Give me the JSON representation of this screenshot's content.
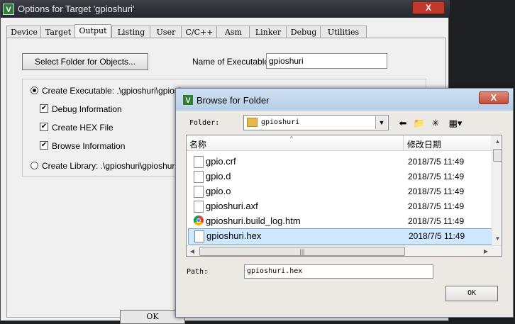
{
  "options_window": {
    "title": "Options for Target 'gpioshuri'",
    "app_icon": "V",
    "close_label": "X",
    "tabs": [
      {
        "label": "Device"
      },
      {
        "label": "Target"
      },
      {
        "label": "Output"
      },
      {
        "label": "Listing"
      },
      {
        "label": "User"
      },
      {
        "label": "C/C++"
      },
      {
        "label": "Asm"
      },
      {
        "label": "Linker"
      },
      {
        "label": "Debug"
      },
      {
        "label": "Utilities"
      }
    ],
    "active_tab": "Output",
    "select_folder_label": "Select Folder for Objects...",
    "name_label": "Name of Executable:",
    "name_value": "gpioshuri",
    "create_exe_label": "Create Executable:  .\\gpioshuri\\gpioshu",
    "create_exe_selected": true,
    "debug_info_label": "Debug Information",
    "create_hex_label": "Create HEX File",
    "browse_info_label": "Browse Information",
    "create_lib_label": "Create Library:  .\\gpioshuri\\gpioshuri.lib",
    "ok_label": "OK"
  },
  "browse_dialog": {
    "title": "Browse for Folder",
    "app_icon": "V",
    "close_label": "X",
    "folder_label": "Folder:",
    "folder_value": "gpioshuri",
    "columns": {
      "name": "名称",
      "date": "修改日期"
    },
    "files": [
      {
        "name": "gpio.crf",
        "date": "2018/7/5 11:49",
        "icon": "file-icon"
      },
      {
        "name": "gpio.d",
        "date": "2018/7/5 11:49",
        "icon": "file-icon"
      },
      {
        "name": "gpio.o",
        "date": "2018/7/5 11:49",
        "icon": "file-icon"
      },
      {
        "name": "gpioshuri.axf",
        "date": "2018/7/5 11:49",
        "icon": "file-icon"
      },
      {
        "name": "gpioshuri.build_log.htm",
        "date": "2018/7/5 11:49",
        "icon": "chrome-icon"
      },
      {
        "name": "gpioshuri.hex",
        "date": "2018/7/5 11:49",
        "icon": "file-icon",
        "selected": true
      }
    ],
    "path_label": "Path:",
    "path_value": "gpioshuri.hex",
    "ok_label": "OK"
  },
  "colors": {
    "selected_row": "#cde8ff",
    "close_red": "#c34c37",
    "title_blue": "#b6cde7"
  }
}
